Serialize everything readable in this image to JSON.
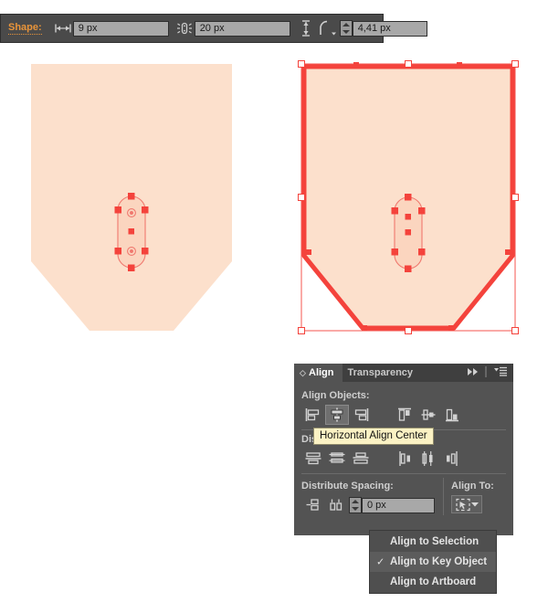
{
  "shape_toolbar": {
    "label": "Shape:",
    "width_icon": "width-arrows-icon",
    "width_value": "9 px",
    "corner_icon": "corner-points-icon",
    "corner_value": "20 px",
    "height_icon": "height-arrows-icon",
    "radius_icon": "corner-radius-icon",
    "radius_value": "4,41 px"
  },
  "canvas": {
    "fill_color": "#fce0cc",
    "stroke_color": "#f4433c",
    "inner_fill_color": "#fbd5bf",
    "left_shape_name": "pentagon-shape-unselected",
    "right_shape_name": "pentagon-shape-selected",
    "inner_shape_name": "stadium-shape"
  },
  "align_panel": {
    "tabs": [
      {
        "label": "Align",
        "active": true
      },
      {
        "label": "Transparency",
        "active": false
      }
    ],
    "collapse_icon": "double-chevron-right-icon",
    "menu_icon": "panel-menu-icon",
    "align_objects": {
      "label": "Align Objects:",
      "buttons": [
        {
          "name": "horizontal-align-left",
          "icon": "align-left-icon",
          "active": false
        },
        {
          "name": "horizontal-align-center",
          "icon": "align-hcenter-icon",
          "active": true
        },
        {
          "name": "horizontal-align-right",
          "icon": "align-right-icon",
          "active": false
        },
        {
          "name": "vertical-align-top",
          "icon": "align-top-icon",
          "active": false
        },
        {
          "name": "vertical-align-center",
          "icon": "align-vcenter-icon",
          "active": false
        },
        {
          "name": "vertical-align-bottom",
          "icon": "align-bottom-icon",
          "active": false
        }
      ]
    },
    "distribute_objects": {
      "label": "Distribute Objects:",
      "buttons": [
        {
          "name": "vertical-distribute-top",
          "icon": "dist-top-icon"
        },
        {
          "name": "vertical-distribute-center",
          "icon": "dist-vcenter-icon"
        },
        {
          "name": "vertical-distribute-bottom",
          "icon": "dist-bottom-icon"
        },
        {
          "name": "horizontal-distribute-left",
          "icon": "dist-left-icon"
        },
        {
          "name": "horizontal-distribute-center",
          "icon": "dist-hcenter-icon"
        },
        {
          "name": "horizontal-distribute-right",
          "icon": "dist-right-icon"
        }
      ]
    },
    "distribute_spacing": {
      "label": "Distribute Spacing:",
      "buttons": [
        {
          "name": "vertical-distribute-space",
          "icon": "dist-vspace-icon"
        },
        {
          "name": "horizontal-distribute-space",
          "icon": "dist-hspace-icon"
        }
      ],
      "value": "0 px"
    },
    "align_to": {
      "label": "Align To:",
      "button_icon": "align-to-key-object-icon",
      "chevron_icon": "chevron-down-icon"
    }
  },
  "tooltip": {
    "text": "Horizontal Align Center"
  },
  "align_to_menu": {
    "items": [
      {
        "label": "Align to Selection",
        "checked": false
      },
      {
        "label": "Align to Key Object",
        "checked": true
      },
      {
        "label": "Align to Artboard",
        "checked": false
      }
    ],
    "check_glyph": "✓"
  }
}
